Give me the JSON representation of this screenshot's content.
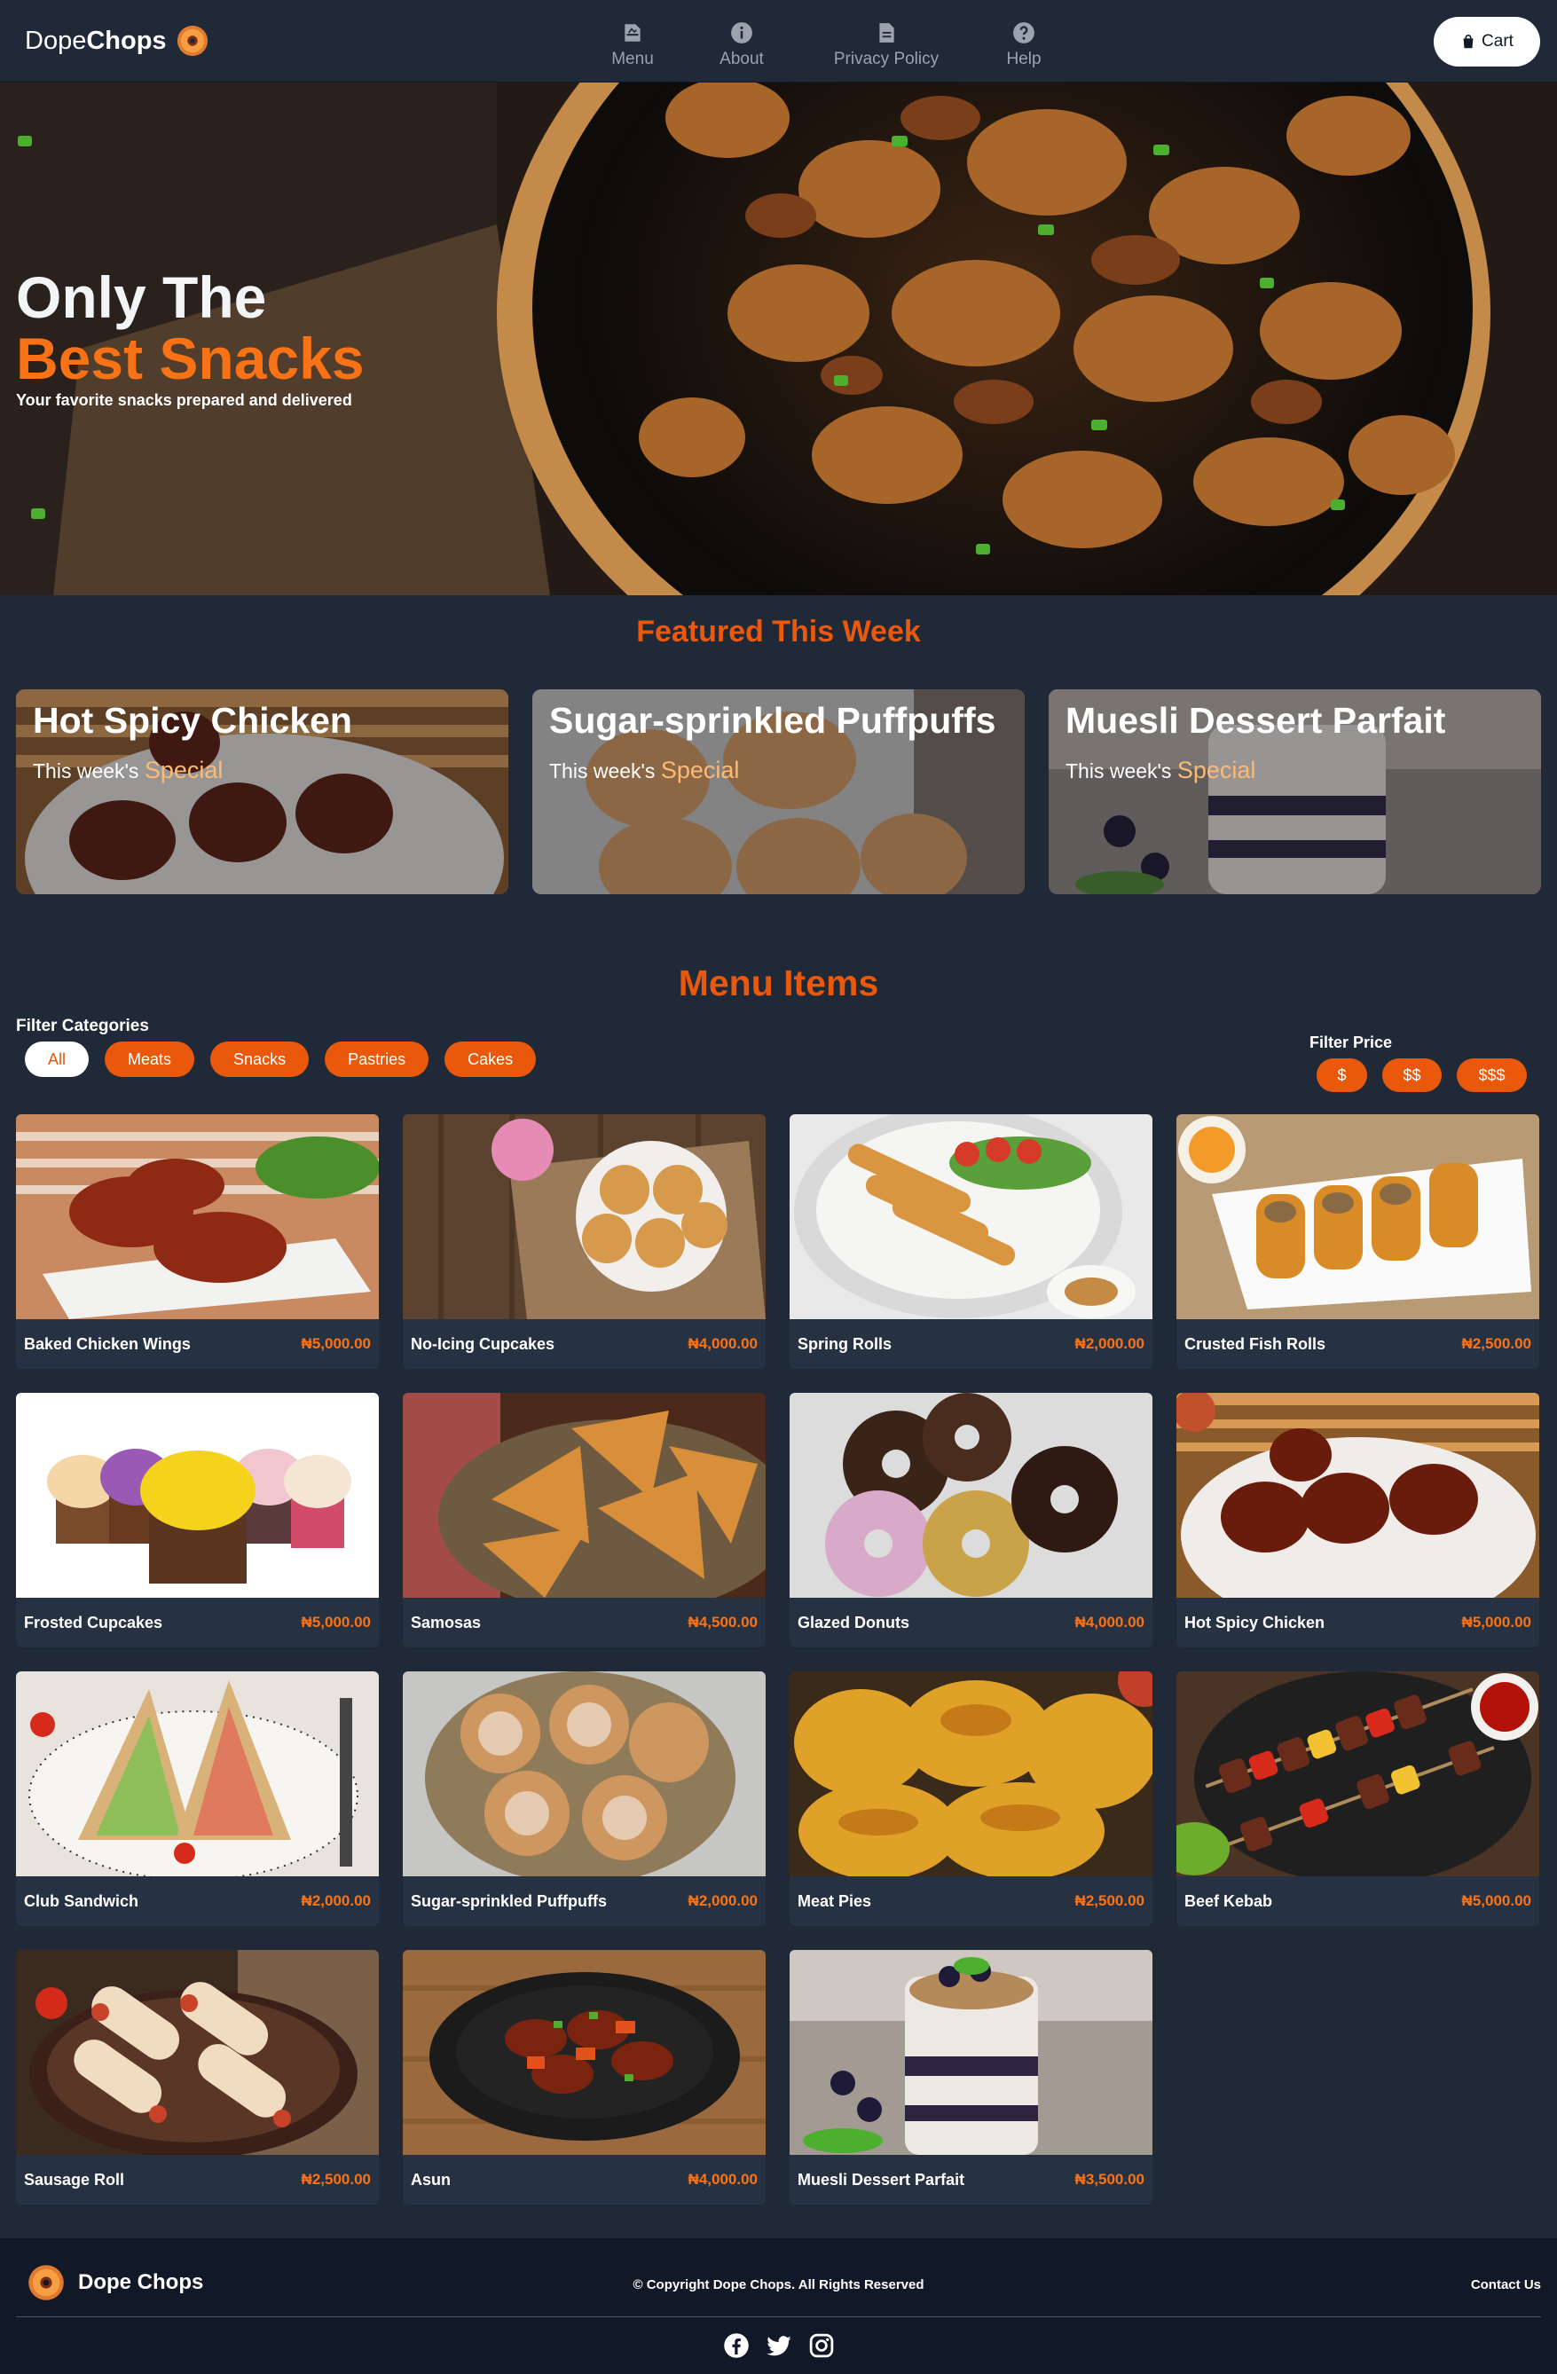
{
  "nav": {
    "brand_light": "Dope",
    "brand_bold": "Chops",
    "links": [
      {
        "label": "Menu",
        "icon": "menu-book-icon"
      },
      {
        "label": "About",
        "icon": "info-icon"
      },
      {
        "label": "Privacy Policy",
        "icon": "document-icon"
      },
      {
        "label": "Help",
        "icon": "help-icon"
      }
    ],
    "cart_label": "Cart"
  },
  "hero": {
    "line1": "Only The",
    "line2": "Best Snacks",
    "subtitle": "Your favorite snacks prepared and delivered"
  },
  "featured": {
    "title": "Featured This Week",
    "prefix": "This week's",
    "accent": "Special",
    "items": [
      {
        "name": "Hot Spicy Chicken"
      },
      {
        "name": "Sugar-sprinkled Puffpuffs"
      },
      {
        "name": "Muesli Dessert Parfait"
      }
    ]
  },
  "menu": {
    "title": "Menu Items",
    "filter_categories_label": "Filter Categories",
    "categories": [
      "All",
      "Meats",
      "Snacks",
      "Pastries",
      "Cakes"
    ],
    "active_category": "All",
    "filter_price_label": "Filter Price",
    "price_levels": [
      "$",
      "$$",
      "$$$"
    ],
    "items": [
      {
        "name": "Baked Chicken Wings",
        "price": "₦5,000.00"
      },
      {
        "name": "No-Icing Cupcakes",
        "price": "₦4,000.00"
      },
      {
        "name": "Spring Rolls",
        "price": "₦2,000.00"
      },
      {
        "name": "Crusted Fish Rolls",
        "price": "₦2,500.00"
      },
      {
        "name": "Frosted Cupcakes",
        "price": "₦5,000.00"
      },
      {
        "name": "Samosas",
        "price": "₦4,500.00"
      },
      {
        "name": "Glazed Donuts",
        "price": "₦4,000.00"
      },
      {
        "name": "Hot Spicy Chicken",
        "price": "₦5,000.00"
      },
      {
        "name": "Club Sandwich",
        "price": "₦2,000.00"
      },
      {
        "name": "Sugar-sprinkled Puffpuffs",
        "price": "₦2,000.00"
      },
      {
        "name": "Meat Pies",
        "price": "₦2,500.00"
      },
      {
        "name": "Beef Kebab",
        "price": "₦5,000.00"
      },
      {
        "name": "Sausage Roll",
        "price": "₦2,500.00"
      },
      {
        "name": "Asun",
        "price": "₦4,000.00"
      },
      {
        "name": "Muesli Dessert Parfait",
        "price": "₦3,500.00"
      }
    ]
  },
  "footer": {
    "brand": "Dope Chops",
    "copyright": "© Copyright Dope Chops. All Rights Reserved",
    "contact": "Contact Us",
    "socials": [
      "facebook-icon",
      "twitter-icon",
      "instagram-icon"
    ]
  },
  "colors": {
    "accent": "#ea580c",
    "accent_light": "#f97316",
    "background": "#1f2937",
    "card": "#263142",
    "footer": "#111827"
  }
}
